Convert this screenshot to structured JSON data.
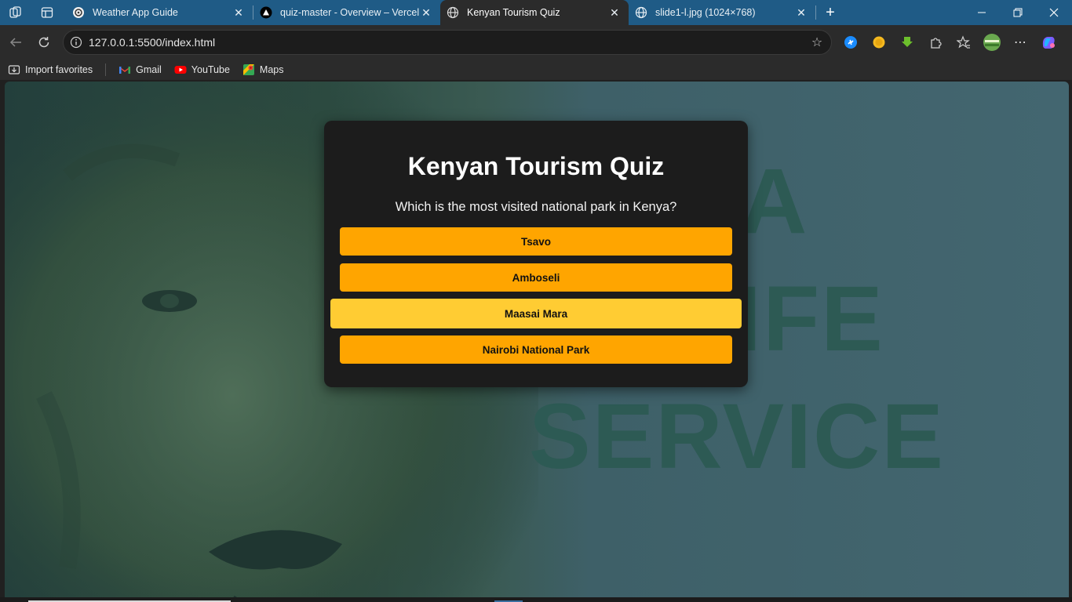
{
  "browser": {
    "tabs": [
      {
        "label": "Weather App Guide",
        "icon": "openai-icon",
        "active": false
      },
      {
        "label": "quiz-master - Overview – Vercel",
        "icon": "vercel-icon",
        "active": false
      },
      {
        "label": "Kenyan Tourism Quiz",
        "icon": "globe-icon",
        "active": true
      },
      {
        "label": "slide1-l.jpg (1024×768)",
        "icon": "globe-icon",
        "active": false
      }
    ],
    "url": "127.0.0.1:5500/index.html",
    "bookmarks": [
      {
        "label": "Import favorites",
        "icon": "import-icon"
      },
      {
        "label": "Gmail",
        "icon": "gmail-icon"
      },
      {
        "label": "YouTube",
        "icon": "youtube-icon"
      },
      {
        "label": "Maps",
        "icon": "maps-icon"
      }
    ]
  },
  "page": {
    "background_text": [
      "NYA",
      "DLIFE",
      "SERVICE"
    ],
    "quiz": {
      "title": "Kenyan Tourism Quiz",
      "question": "Which is the most visited national park in Kenya?",
      "options": [
        "Tsavo",
        "Amboseli",
        "Maasai Mara",
        "Nairobi National Park"
      ],
      "hovered_option": "Maasai Mara"
    }
  },
  "colors": {
    "option": "#ffa500",
    "option_hover": "#ffcc33",
    "card": "#1c1c1c",
    "titlebar": "#1f5b86"
  }
}
